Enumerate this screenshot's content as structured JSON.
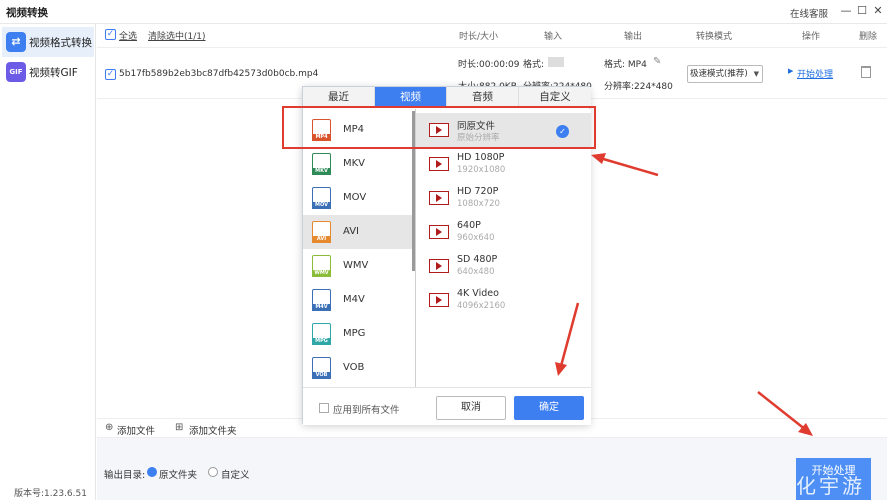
{
  "window": {
    "title": "视频转换",
    "support": "在线客服",
    "controls": [
      "—",
      "☐",
      "✕"
    ]
  },
  "sidebar": {
    "items": [
      {
        "label": "视频格式转换",
        "icon": "convert-icon",
        "active": true
      },
      {
        "label": "视频转GIF",
        "icon": "gif-icon",
        "active": false
      }
    ],
    "version": "版本号:1.23.6.51"
  },
  "header": {
    "select_all": "全选",
    "clear_selected": "清除选中(1/1)",
    "col_duration": "时长/大小",
    "col_input": "输入",
    "col_output": "输出",
    "col_mode": "转换模式",
    "col_action": "操作",
    "col_delete": "删除"
  },
  "file": {
    "name": "5b17fb589b2eb3bc87dfb42573d0b0cb.mp4",
    "duration": "时长:00:00:09",
    "size": "大小:882.0KB",
    "input_format": "格式:",
    "input_res": "分辨率:224*480",
    "output_format": "格式: MP4",
    "output_res": "分辨率:224*480",
    "mode": "极速模式(推荐)",
    "start": "开始处理"
  },
  "popup": {
    "tabs": [
      "最近",
      "视频",
      "音频",
      "自定义"
    ],
    "active_tab": 1,
    "formats": [
      {
        "label": "MP4",
        "band": "MP4",
        "color": "#d9532c",
        "selected": false
      },
      {
        "label": "MKV",
        "band": "MKV",
        "color": "#2e8b57",
        "selected": false
      },
      {
        "label": "MOV",
        "band": "MOV",
        "color": "#3b6fb6",
        "selected": false
      },
      {
        "label": "AVI",
        "band": "AVI",
        "color": "#e58a2e",
        "selected": true
      },
      {
        "label": "WMV",
        "band": "WMV",
        "color": "#8bbd3a",
        "selected": false
      },
      {
        "label": "M4V",
        "band": "M4V",
        "color": "#3b6fb6",
        "selected": false
      },
      {
        "label": "MPG",
        "band": "MPG",
        "color": "#2fa7a7",
        "selected": false
      },
      {
        "label": "VOB",
        "band": "VOB",
        "color": "#3b6fb6",
        "selected": false
      }
    ],
    "resolutions": [
      {
        "name": "同原文件",
        "sub": "原始分辨率",
        "selected": true
      },
      {
        "name": "HD 1080P",
        "sub": "1920x1080",
        "selected": false
      },
      {
        "name": "HD 720P",
        "sub": "1080x720",
        "selected": false
      },
      {
        "name": "640P",
        "sub": "960x640",
        "selected": false
      },
      {
        "name": "SD 480P",
        "sub": "640x480",
        "selected": false
      },
      {
        "name": "4K Video",
        "sub": "4096x2160",
        "selected": false
      }
    ],
    "apply_all": "应用到所有文件",
    "cancel": "取消",
    "confirm": "确定"
  },
  "bottom": {
    "add_file": "添加文件",
    "add_folder": "添加文件夹",
    "output_dir_label": "输出目录:",
    "opt_source": "原文件夹",
    "opt_custom": "自定义",
    "start_button": "开始处理"
  },
  "watermark": "化宇游",
  "colors": {
    "accent": "#3d7ef0",
    "annotation": "#e03b2f"
  }
}
